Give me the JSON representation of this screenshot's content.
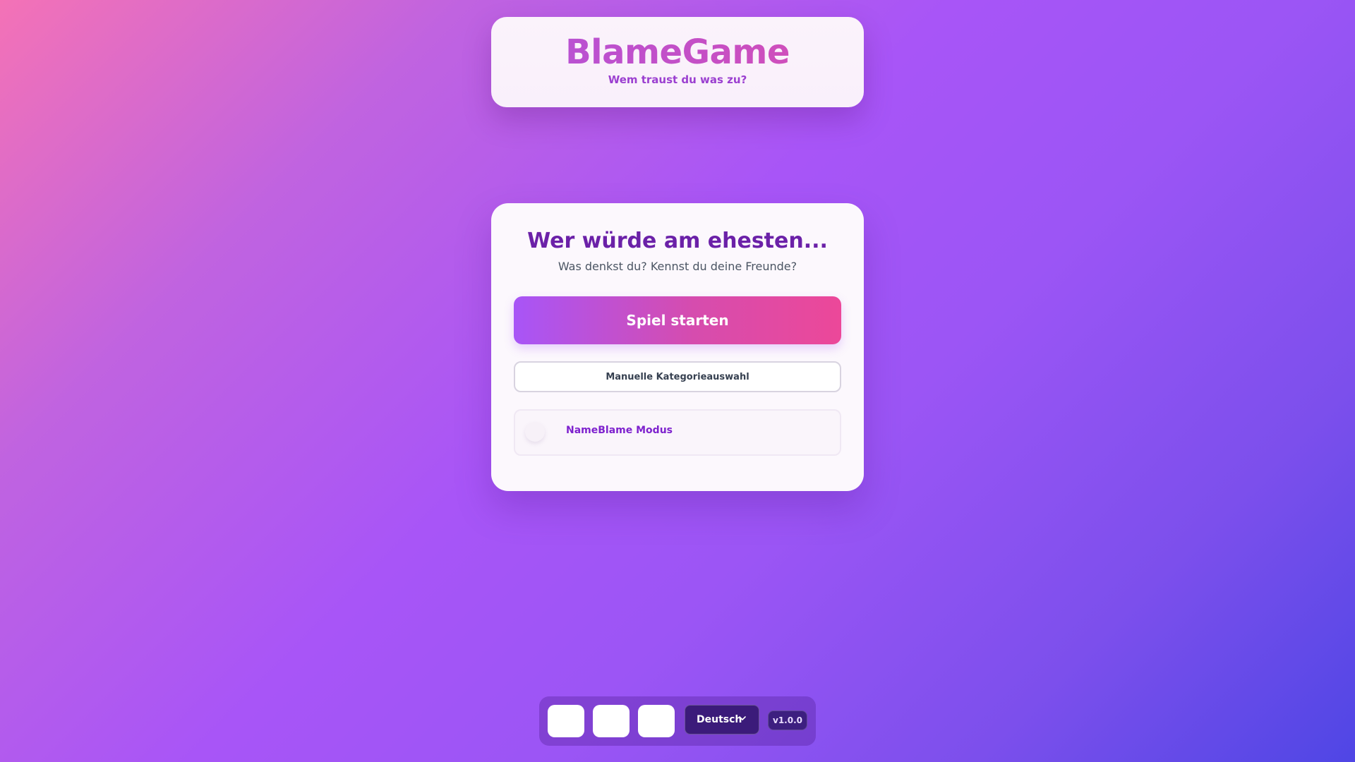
{
  "header": {
    "title": "BlameGame",
    "subtitle": "Wem traust du was zu?"
  },
  "main": {
    "title": "Wer würde am ehesten...",
    "subtitle": "Was denkst du? Kennst du deine Freunde?",
    "start_label": "Spiel starten",
    "manual_label": "Manuelle Kategorieauswahl",
    "mode_label": "NameBlame Modus",
    "mode_enabled": false
  },
  "footer": {
    "language": "Deutsch",
    "version": "v1.0.0",
    "icon_buttons": [
      "icon-button-1",
      "icon-button-2",
      "icon-button-3"
    ]
  },
  "colors": {
    "accent_purple": "#a855f7",
    "accent_pink": "#ec4899",
    "title_purple": "#6b21a8"
  }
}
